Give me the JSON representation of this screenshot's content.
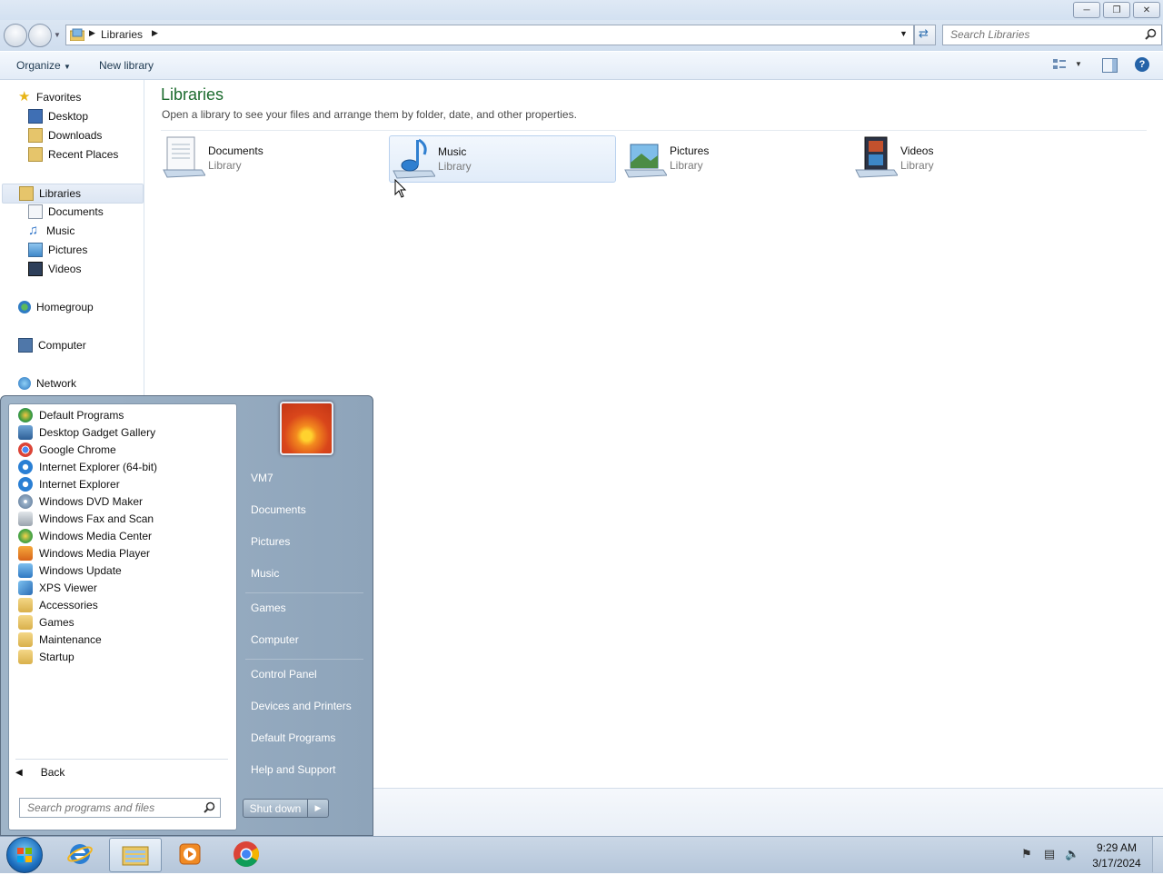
{
  "window": {
    "caption_buttons": [
      "minimize-icon",
      "restore-icon",
      "close-icon"
    ],
    "address": {
      "breadcrumb": "Libraries"
    },
    "search": {
      "placeholder": "Search Libraries"
    },
    "toolbar": {
      "organize_label": "Organize",
      "new_library_label": "New library"
    }
  },
  "sidebar": {
    "favorites": {
      "label": "Favorites",
      "items": [
        "Desktop",
        "Downloads",
        "Recent Places"
      ]
    },
    "libraries": {
      "label": "Libraries",
      "items": [
        "Documents",
        "Music",
        "Pictures",
        "Videos"
      ]
    },
    "homegroup": "Homegroup",
    "computer": "Computer",
    "network": "Network"
  },
  "content": {
    "title": "Libraries",
    "description": "Open a library to see your files and arrange them by folder, date, and other properties.",
    "libraries": [
      {
        "name": "Documents",
        "sub": "Library"
      },
      {
        "name": "Music",
        "sub": "Library"
      },
      {
        "name": "Pictures",
        "sub": "Library"
      },
      {
        "name": "Videos",
        "sub": "Library"
      }
    ]
  },
  "start_menu": {
    "programs": [
      "Default Programs",
      "Desktop Gadget Gallery",
      "Google Chrome",
      "Internet Explorer (64-bit)",
      "Internet Explorer",
      "Windows DVD Maker",
      "Windows Fax and Scan",
      "Windows Media Center",
      "Windows Media Player",
      "Windows Update",
      "XPS Viewer",
      "Accessories",
      "Games",
      "Maintenance",
      "Startup"
    ],
    "back_label": "Back",
    "search_placeholder": "Search programs and files",
    "right_links": [
      "VM7",
      "Documents",
      "Pictures",
      "Music",
      "Games",
      "Computer",
      "Control Panel",
      "Devices and Printers",
      "Default Programs",
      "Help and Support"
    ],
    "shutdown_label": "Shut down"
  },
  "taskbar": {
    "apps": [
      "internet-explorer-icon",
      "windows-explorer-icon",
      "windows-media-player-icon",
      "google-chrome-icon"
    ],
    "clock": {
      "time": "9:29 AM",
      "date": "3/17/2024"
    }
  }
}
